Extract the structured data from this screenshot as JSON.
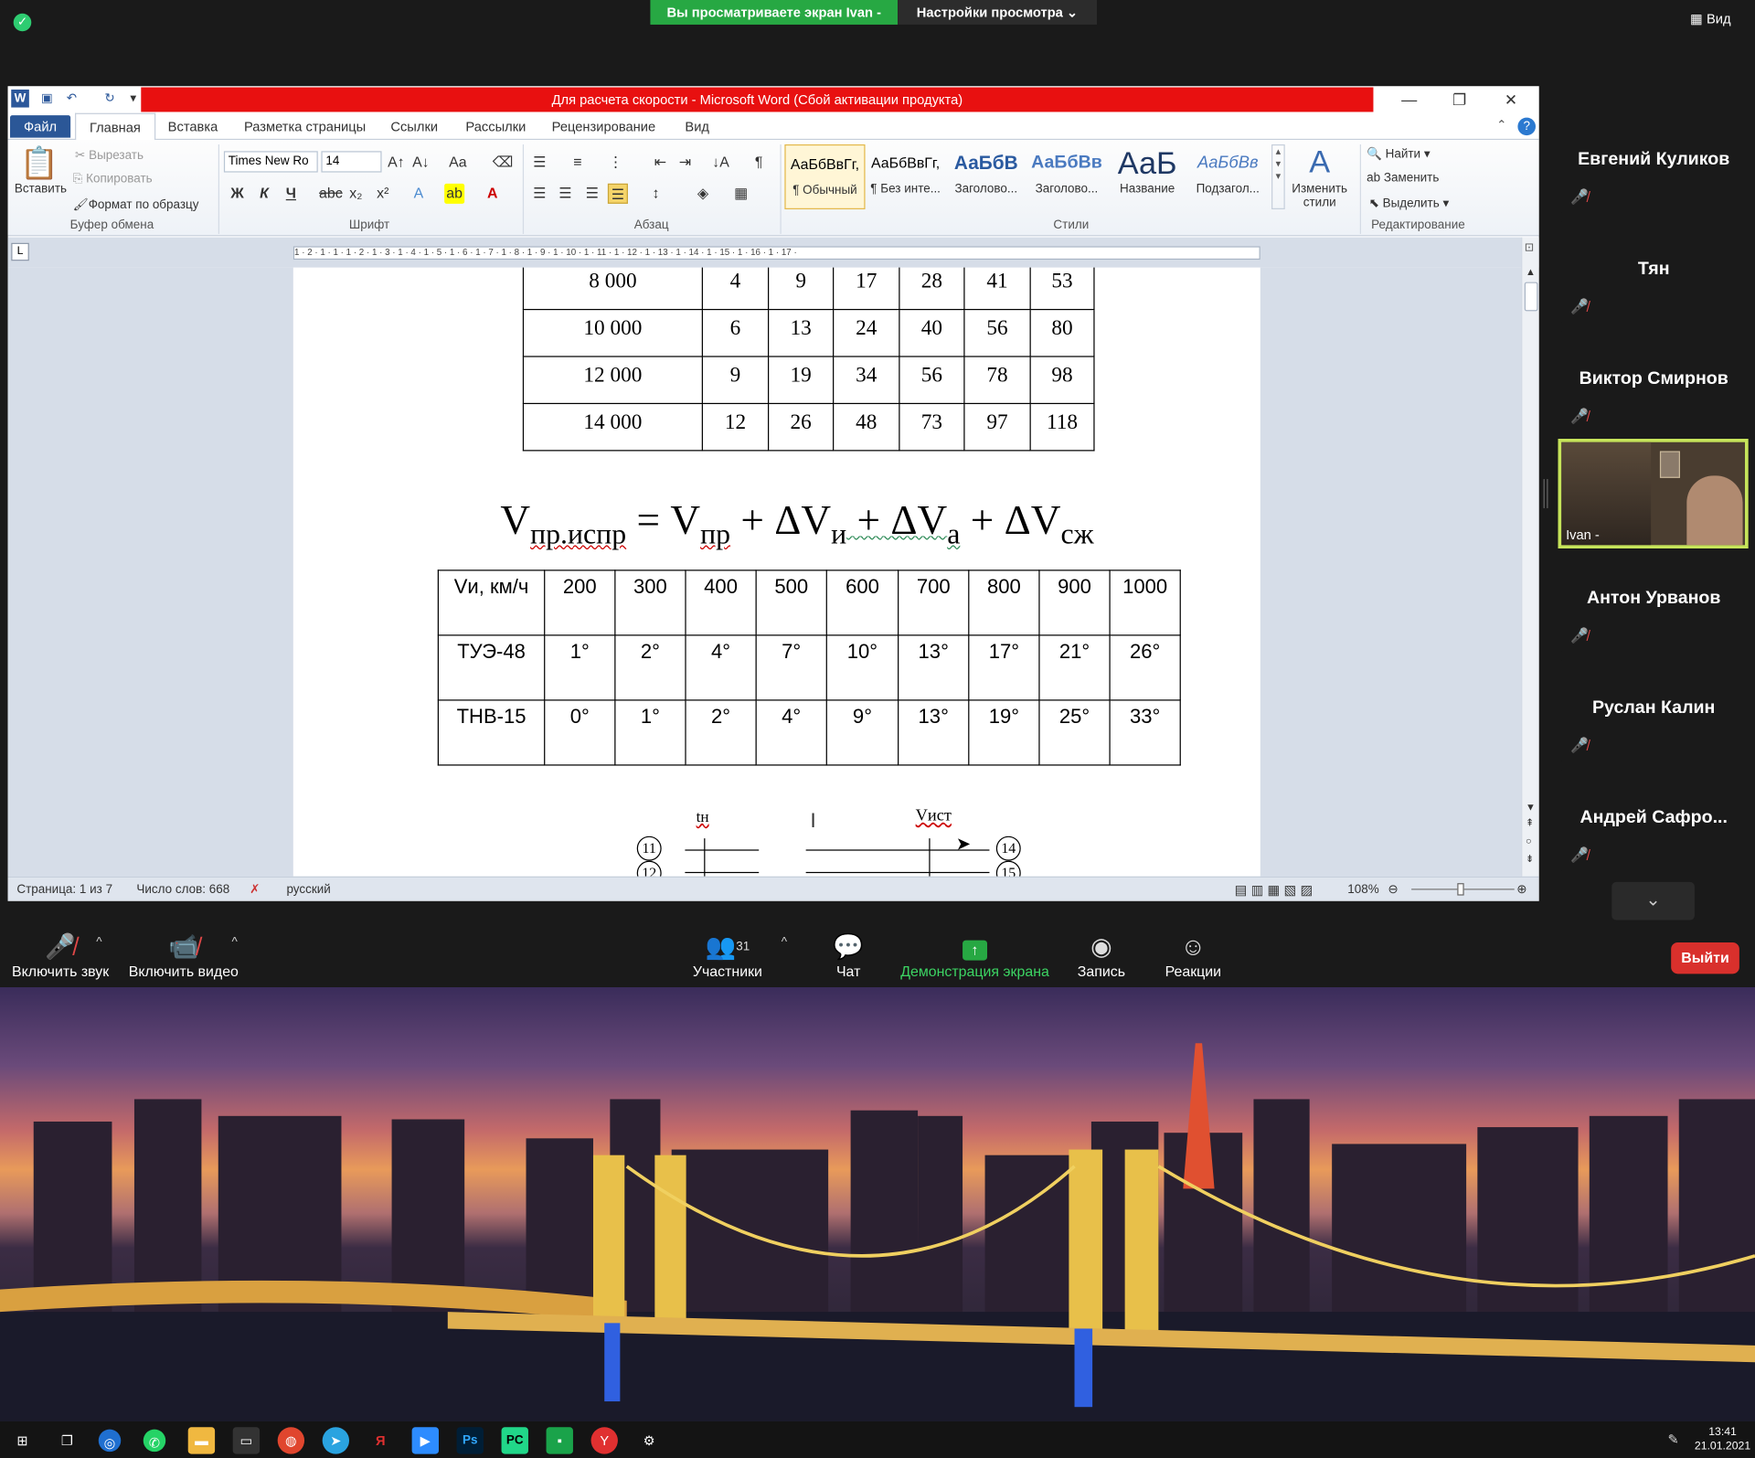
{
  "zoom": {
    "share_banner": "Вы просматриваете экран Ivan -",
    "view_settings": "Настройки просмотра ⌄",
    "view_button": "Вид",
    "participants": [
      {
        "name": "Евгений Куликов"
      },
      {
        "name": "Тян"
      },
      {
        "name": "Виктор Смирнов"
      },
      {
        "name": "Антон Урванов"
      },
      {
        "name": "Руслан Калин"
      },
      {
        "name": "Андрей  Сафро..."
      }
    ],
    "video_participant": "Ivan -",
    "toolbar": {
      "mute": "Включить звук",
      "video": "Включить видео",
      "participants": "Участники",
      "participants_count": "31",
      "chat": "Чат",
      "share": "Демонстрация экрана",
      "record": "Запись",
      "reactions": "Реакции",
      "leave": "Выйти"
    },
    "colors": {
      "share_green": "#27a843",
      "leave_red": "#d9302c",
      "active_speaker": "#c6e45a"
    }
  },
  "word": {
    "title": "Для расчета скорости  -  Microsoft Word (Сбой активации продукта)",
    "tabs": [
      "Файл",
      "Главная",
      "Вставка",
      "Разметка страницы",
      "Ссылки",
      "Рассылки",
      "Рецензирование",
      "Вид"
    ],
    "clipboard": {
      "paste": "Вставить",
      "cut": "Вырезать",
      "copy": "Копировать",
      "format_painter": "Формат по образцу",
      "label": "Буфер обмена"
    },
    "font": {
      "family": "Times New Ro",
      "size": "14",
      "label": "Шрифт"
    },
    "paragraph_label": "Абзац",
    "styles": [
      {
        "sample": "АаБбВвГг,",
        "name": "¶ Обычный"
      },
      {
        "sample": "АаБбВвГг,",
        "name": "¶ Без инте..."
      },
      {
        "sample": "АаБбВ",
        "name": "Заголово..."
      },
      {
        "sample": "АаБбВв",
        "name": "Заголово..."
      },
      {
        "sample": "АаБ",
        "name": "Название"
      },
      {
        "sample": "АаБбВв",
        "name": "Подзагол..."
      }
    ],
    "change_styles": "Изменить стили",
    "styles_label": "Стили",
    "editing": {
      "find": "Найти",
      "replace": "Заменить",
      "select": "Выделить",
      "label": "Редактирование"
    },
    "ruler": "1 · 2 · 1 · 1 · 1 · 2 · 1 · 3 · 1 · 4 · 1 · 5 · 1 · 6 · 1 · 7 · 1 · 8 · 1 · 9 · 1 · 10 · 1 · 11 · 1 · 12 · 1 · 13 · 1 · 14 · 1 · 15 · 1 · 16 · 1 · 17 ·",
    "status": {
      "page": "Страница: 1 из 7",
      "words": "Число слов: 668",
      "language": "русский",
      "zoom": "108%"
    }
  },
  "document": {
    "table1": [
      [
        "8 000",
        "4",
        "9",
        "17",
        "28",
        "41",
        "53"
      ],
      [
        "10 000",
        "6",
        "13",
        "24",
        "40",
        "56",
        "80"
      ],
      [
        "12 000",
        "9",
        "19",
        "34",
        "56",
        "78",
        "98"
      ],
      [
        "14 000",
        "12",
        "26",
        "48",
        "73",
        "97",
        "118"
      ]
    ],
    "formula": {
      "v": "V",
      "sub1": "пр.испр",
      "eq": " = V",
      "sub2": "пр",
      "p1": " + ΔV",
      "sub3": "и",
      "p2": " +  ΔV",
      "sub4": "а",
      "p3": " +  ΔV",
      "sub5": "сж"
    },
    "table2": {
      "header": [
        "Vи, км/ч",
        "200",
        "300",
        "400",
        "500",
        "600",
        "700",
        "800",
        "900",
        "1000"
      ],
      "rows": [
        [
          "ТУЭ-48",
          "1°",
          "2°",
          "4°",
          "7°",
          "10°",
          "13°",
          "17°",
          "21°",
          "26°"
        ],
        [
          "ТНВ-15",
          "0°",
          "1°",
          "2°",
          "4°",
          "9°",
          "13°",
          "19°",
          "25°",
          "33°"
        ]
      ]
    },
    "diagram": {
      "label_left": "tн",
      "label_right": "Vист",
      "n11": "11",
      "n12": "12",
      "n14": "14",
      "n15": "15"
    }
  },
  "taskbar": {
    "time": "13:41",
    "date": "21.01.2021"
  }
}
